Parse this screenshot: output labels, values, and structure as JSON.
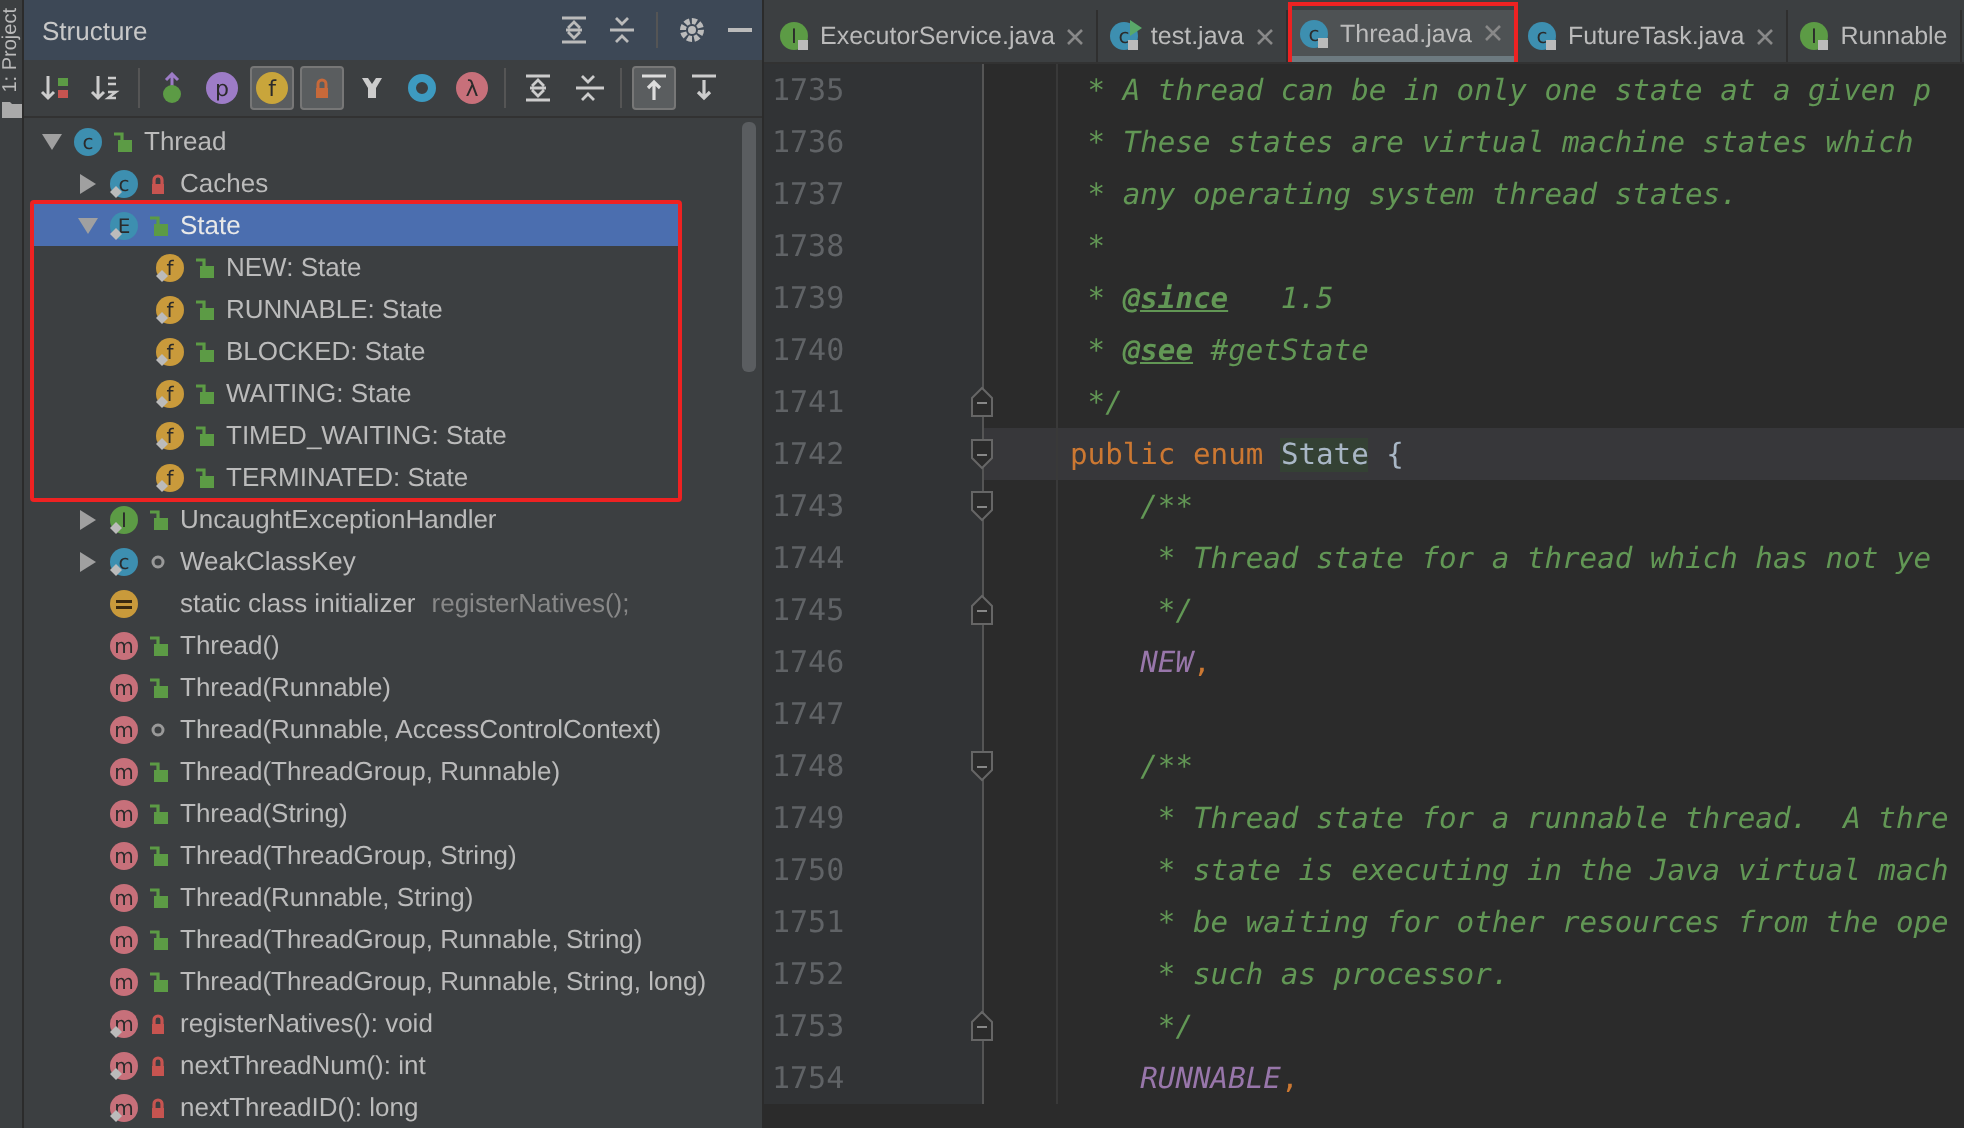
{
  "side_strip": {
    "label": "1: Project"
  },
  "structure": {
    "title": "Structure",
    "toolbar": [
      {
        "kind": "sort-visibility",
        "on": false
      },
      {
        "kind": "sort-alpha",
        "on": false
      },
      {
        "kind": "inherited",
        "on": false
      },
      {
        "kind": "letter",
        "glyph": "p",
        "color": "#9d7cc7",
        "on": false
      },
      {
        "kind": "letter",
        "glyph": "f",
        "color": "#c9a53b",
        "on": true
      },
      {
        "kind": "lock",
        "on": true
      },
      {
        "kind": "anonymous",
        "on": false
      },
      {
        "kind": "ring",
        "on": false
      },
      {
        "kind": "letter",
        "glyph": "λ",
        "color": "#c7707a",
        "on": false
      },
      {
        "kind": "expand",
        "on": false
      },
      {
        "kind": "collapse",
        "on": false
      },
      {
        "kind": "scroll-to",
        "on": true
      },
      {
        "kind": "scroll-from",
        "on": false
      }
    ],
    "tree": [
      {
        "label": "Thread",
        "kind": "class",
        "glyph": "c",
        "access": {
          "kind": "public"
        },
        "static": false,
        "expanded": true,
        "selected": false,
        "highlighted": false,
        "children": [
          {
            "label": "Caches",
            "kind": "class",
            "glyph": "c",
            "access": {
              "kind": "private"
            },
            "static": true,
            "expanded": false,
            "selected": false,
            "highlighted": false
          },
          {
            "label": "State",
            "kind": "enum",
            "glyph": "E",
            "access": {
              "kind": "public"
            },
            "static": true,
            "expanded": true,
            "selected": true,
            "highlighted": true,
            "children": [
              {
                "label": "NEW: State",
                "kind": "field",
                "glyph": "f",
                "access": {
                  "kind": "public"
                },
                "static": true,
                "selected": false,
                "highlighted": false
              },
              {
                "label": "RUNNABLE: State",
                "kind": "field",
                "glyph": "f",
                "access": {
                  "kind": "public"
                },
                "static": true,
                "selected": false,
                "highlighted": false
              },
              {
                "label": "BLOCKED: State",
                "kind": "field",
                "glyph": "f",
                "access": {
                  "kind": "public"
                },
                "static": true,
                "selected": false,
                "highlighted": false
              },
              {
                "label": "WAITING: State",
                "kind": "field",
                "glyph": "f",
                "access": {
                  "kind": "public"
                },
                "static": true,
                "selected": false,
                "highlighted": false
              },
              {
                "label": "TIMED_WAITING: State",
                "kind": "field",
                "glyph": "f",
                "access": {
                  "kind": "public"
                },
                "static": true,
                "selected": false,
                "highlighted": false
              },
              {
                "label": "TERMINATED: State",
                "kind": "field",
                "glyph": "f",
                "access": {
                  "kind": "public"
                },
                "static": true,
                "selected": false,
                "highlighted": false
              }
            ]
          },
          {
            "label": "UncaughtExceptionHandler",
            "kind": "interface",
            "glyph": "I",
            "access": {
              "kind": "public"
            },
            "static": true,
            "expanded": false,
            "selected": false,
            "highlighted": false
          },
          {
            "label": "WeakClassKey",
            "kind": "class",
            "glyph": "c",
            "access": {
              "kind": "package"
            },
            "static": true,
            "expanded": false,
            "selected": false,
            "highlighted": false
          },
          {
            "label": "static class initializer",
            "detail": "registerNatives();",
            "kind": "initializer",
            "static": false,
            "selected": false,
            "highlighted": false
          },
          {
            "label": "Thread()",
            "kind": "method",
            "glyph": "m",
            "access": {
              "kind": "public"
            },
            "static": false,
            "selected": false,
            "highlighted": false
          },
          {
            "label": "Thread(Runnable)",
            "kind": "method",
            "glyph": "m",
            "access": {
              "kind": "public"
            },
            "static": false,
            "selected": false,
            "highlighted": false
          },
          {
            "label": "Thread(Runnable, AccessControlContext)",
            "kind": "method",
            "glyph": "m",
            "access": {
              "kind": "package"
            },
            "static": false,
            "selected": false,
            "highlighted": false
          },
          {
            "label": "Thread(ThreadGroup, Runnable)",
            "kind": "method",
            "glyph": "m",
            "access": {
              "kind": "public"
            },
            "static": false,
            "selected": false,
            "highlighted": false
          },
          {
            "label": "Thread(String)",
            "kind": "method",
            "glyph": "m",
            "access": {
              "kind": "public"
            },
            "static": false,
            "selected": false,
            "highlighted": false
          },
          {
            "label": "Thread(ThreadGroup, String)",
            "kind": "method",
            "glyph": "m",
            "access": {
              "kind": "public"
            },
            "static": false,
            "selected": false,
            "highlighted": false
          },
          {
            "label": "Thread(Runnable, String)",
            "kind": "method",
            "glyph": "m",
            "access": {
              "kind": "public"
            },
            "static": false,
            "selected": false,
            "highlighted": false
          },
          {
            "label": "Thread(ThreadGroup, Runnable, String)",
            "kind": "method",
            "glyph": "m",
            "access": {
              "kind": "public"
            },
            "static": false,
            "selected": false,
            "highlighted": false
          },
          {
            "label": "Thread(ThreadGroup, Runnable, String, long)",
            "kind": "method",
            "glyph": "m",
            "access": {
              "kind": "public"
            },
            "static": false,
            "selected": false,
            "highlighted": false
          },
          {
            "label": "registerNatives(): void",
            "kind": "method",
            "glyph": "m",
            "access": {
              "kind": "private"
            },
            "static": true,
            "selected": false,
            "highlighted": false
          },
          {
            "label": "nextThreadNum(): int",
            "kind": "method",
            "glyph": "m",
            "access": {
              "kind": "private"
            },
            "static": true,
            "selected": false,
            "highlighted": false
          },
          {
            "label": "nextThreadID(): long",
            "kind": "method",
            "glyph": "m",
            "access": {
              "kind": "private"
            },
            "static": true,
            "selected": false,
            "highlighted": false
          }
        ]
      }
    ]
  },
  "editor": {
    "tabs": [
      {
        "label": "ExecutorService.java",
        "kind": "interface",
        "glyph": "I",
        "run_mark": false,
        "selected": false,
        "highlighted": false,
        "closable": true
      },
      {
        "label": "test.java",
        "kind": "class",
        "glyph": "c",
        "run_mark": true,
        "selected": false,
        "highlighted": false,
        "closable": true
      },
      {
        "label": "Thread.java",
        "kind": "class",
        "glyph": "c",
        "run_mark": false,
        "selected": true,
        "highlighted": true,
        "closable": true
      },
      {
        "label": "FutureTask.java",
        "kind": "class",
        "glyph": "c",
        "run_mark": false,
        "selected": false,
        "highlighted": false,
        "closable": true
      },
      {
        "label": "Runnable",
        "kind": "interface",
        "glyph": "I",
        "run_mark": false,
        "selected": false,
        "highlighted": false,
        "closable": false
      }
    ],
    "lines": [
      {
        "number": "1735",
        "current": false,
        "tokens": [
          {
            "kind": "doc",
            "text": " * A thread can be in only one state at a given p"
          }
        ]
      },
      {
        "number": "1736",
        "current": false,
        "tokens": [
          {
            "kind": "doc",
            "text": " * These states are virtual machine states which"
          }
        ]
      },
      {
        "number": "1737",
        "current": false,
        "tokens": [
          {
            "kind": "doc",
            "text": " * any operating system thread states."
          }
        ]
      },
      {
        "number": "1738",
        "current": false,
        "tokens": [
          {
            "kind": "doc",
            "text": " *"
          }
        ]
      },
      {
        "number": "1739",
        "current": false,
        "tokens": [
          {
            "kind": "doc",
            "text": " * "
          },
          {
            "kind": "tag",
            "text": "@since"
          },
          {
            "kind": "doc",
            "text": "   1.5"
          }
        ]
      },
      {
        "number": "1740",
        "current": false,
        "tokens": [
          {
            "kind": "doc",
            "text": " * "
          },
          {
            "kind": "tag",
            "text": "@see"
          },
          {
            "kind": "doc",
            "text": " #getState"
          }
        ]
      },
      {
        "number": "1741",
        "current": false,
        "fold": {
          "kind": "end"
        },
        "tokens": [
          {
            "kind": "doc",
            "text": " */"
          }
        ]
      },
      {
        "number": "1742",
        "current": true,
        "fold": {
          "kind": "start"
        },
        "tokens": [
          {
            "kind": "kw",
            "text": "public enum "
          },
          {
            "kind": "match",
            "text": "State"
          },
          {
            "kind": "id",
            "text": " {"
          }
        ]
      },
      {
        "number": "1743",
        "current": false,
        "fold": {
          "kind": "start"
        },
        "tokens": [
          {
            "kind": "doc",
            "text": "    /**"
          }
        ]
      },
      {
        "number": "1744",
        "current": false,
        "tokens": [
          {
            "kind": "doc",
            "text": "     * Thread state for a thread which has not ye"
          }
        ]
      },
      {
        "number": "1745",
        "current": false,
        "fold": {
          "kind": "end"
        },
        "tokens": [
          {
            "kind": "doc",
            "text": "     */"
          }
        ]
      },
      {
        "number": "1746",
        "current": false,
        "tokens": [
          {
            "kind": "const",
            "text": "    NEW"
          },
          {
            "kind": "punct",
            "text": ","
          }
        ]
      },
      {
        "number": "1747",
        "current": false
      },
      {
        "number": "1748",
        "current": false,
        "fold": {
          "kind": "start"
        },
        "tokens": [
          {
            "kind": "doc",
            "text": "    /**"
          }
        ]
      },
      {
        "number": "1749",
        "current": false,
        "tokens": [
          {
            "kind": "doc",
            "text": "     * Thread state for a runnable thread.  A thre"
          }
        ]
      },
      {
        "number": "1750",
        "current": false,
        "tokens": [
          {
            "kind": "doc",
            "text": "     * state is executing in the Java virtual mach"
          }
        ]
      },
      {
        "number": "1751",
        "current": false,
        "tokens": [
          {
            "kind": "doc",
            "text": "     * be waiting for other resources from the ope"
          }
        ]
      },
      {
        "number": "1752",
        "current": false,
        "tokens": [
          {
            "kind": "doc",
            "text": "     * such as processor."
          }
        ]
      },
      {
        "number": "1753",
        "current": false,
        "fold": {
          "kind": "end"
        },
        "tokens": [
          {
            "kind": "doc",
            "text": "     */"
          }
        ]
      },
      {
        "number": "1754",
        "current": false,
        "tokens": [
          {
            "kind": "const",
            "text": "    RUNNABLE"
          },
          {
            "kind": "punct",
            "text": ","
          }
        ]
      }
    ]
  }
}
